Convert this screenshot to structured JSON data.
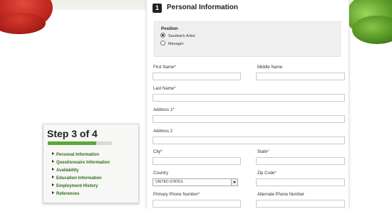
{
  "step": {
    "title": "Step 3 of 4",
    "progress_fraction": 0.75,
    "items": [
      "Personal Information",
      "Questionnaire Information",
      "Availability",
      "Education Information",
      "Employment History",
      "References"
    ]
  },
  "section": {
    "number": "1",
    "title": "Personal Information"
  },
  "position": {
    "label": "Position",
    "options": [
      "Sandwich Artist",
      "Manager"
    ],
    "selected": "Sandwich Artist"
  },
  "fields": {
    "first_name": "First Name*",
    "middle_name": "Middle Name",
    "last_name": "Last Name*",
    "address1": "Address 1*",
    "address2": "Address 2",
    "city": "City*",
    "state": "State*",
    "country": "Country",
    "country_value": "UNITED STATES",
    "zip": "Zip Code*",
    "primary_phone": "Primary Phone Number*",
    "alternate_phone": "Alternate Phone Number"
  },
  "colors": {
    "accent_green": "#5aa83a",
    "link_green": "#2e6d17"
  }
}
